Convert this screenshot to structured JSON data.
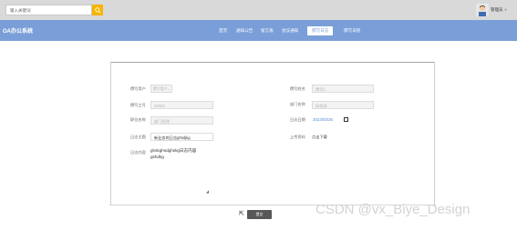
{
  "topbar": {
    "search_placeholder": "输入关键词",
    "user_name": "管理员",
    "user_caret": "∨"
  },
  "navbar": {
    "brand": "OA办公系统",
    "items": [
      {
        "label": "首页",
        "active": false
      },
      {
        "label": "通知公告",
        "active": false
      },
      {
        "label": "留言板",
        "active": false
      },
      {
        "label": "会议通知",
        "active": false
      },
      {
        "label": "撰写日志",
        "active": true
      },
      {
        "label": "撰写日程",
        "active": false
      }
    ]
  },
  "form": {
    "left": [
      {
        "label": "撰写用户",
        "value": "撰写用户",
        "type": "select"
      },
      {
        "label": "撰写工号",
        "value": "20002",
        "type": "disabled"
      },
      {
        "label": "职位名称",
        "value": "部门经理",
        "type": "disabled"
      },
      {
        "label": "日志主题",
        "value": "新业务的日志ghsdjkg",
        "type": "text"
      }
    ],
    "right": [
      {
        "label": "撰写姓名",
        "value": "撰写2",
        "type": "disabled"
      },
      {
        "label": "部门名称",
        "value": "研发部",
        "type": "disabled"
      },
      {
        "label": "日志日期",
        "value": "2023/03/26",
        "type": "date"
      },
      {
        "label": "上传资料",
        "value": "点击下载",
        "type": "link"
      }
    ],
    "content_label": "日志内容",
    "content_lines": [
      "ghskghsdghskg日志内容",
      "gshdkg"
    ],
    "submit_label": "提交"
  },
  "watermark": "CSDN @vx_Biye_Design",
  "colors": {
    "accent": "#7a9fd8",
    "search_button": "#f5b400",
    "submit": "#575757",
    "date_text": "#4e8bd6"
  }
}
